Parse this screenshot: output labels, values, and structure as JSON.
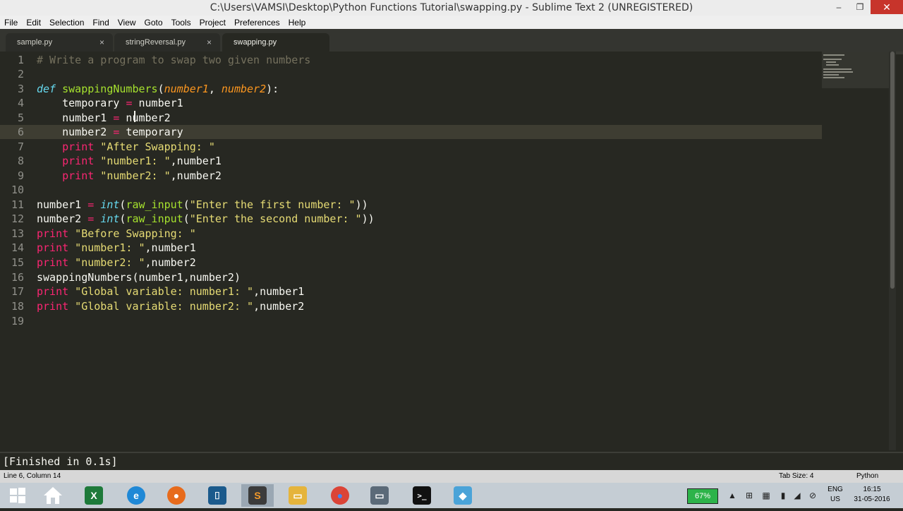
{
  "window": {
    "title": "C:\\Users\\VAMSI\\Desktop\\Python Functions Tutorial\\swapping.py - Sublime Text 2 (UNREGISTERED)",
    "minimize": "–",
    "maximize": "❐",
    "close": "✕"
  },
  "menu": [
    "File",
    "Edit",
    "Selection",
    "Find",
    "View",
    "Goto",
    "Tools",
    "Project",
    "Preferences",
    "Help"
  ],
  "tabs": [
    {
      "label": "sample.py",
      "close": "×"
    },
    {
      "label": "stringReversal.py",
      "close": "×"
    },
    {
      "label": "swapping.py",
      "close": ""
    }
  ],
  "editor": {
    "line_numbers": [
      "1",
      "2",
      "3",
      "4",
      "5",
      "6",
      "7",
      "8",
      "9",
      "10",
      "11",
      "12",
      "13",
      "14",
      "15",
      "16",
      "17",
      "18",
      "19"
    ],
    "l1": "# Write a program to swap two given numbers",
    "l3": {
      "def": "def",
      "name": "swappingNumbers",
      "open": "(",
      "p1": "number1",
      "comma": ", ",
      "p2": "number2",
      "close": "):"
    },
    "l4": {
      "a": "    temporary ",
      "op": "=",
      "b": " number1"
    },
    "l5": {
      "a": "    number1 ",
      "op": "=",
      "b": " number2"
    },
    "l6": {
      "a": "    number2 ",
      "op": "=",
      "b": " temporary"
    },
    "l7": {
      "kw": "    print",
      "str": " \"After Swapping: \""
    },
    "l8": {
      "kw": "    print",
      "str": " \"number1: \"",
      "rest": ",number1"
    },
    "l9": {
      "kw": "    print",
      "str": " \"number2: \"",
      "rest": ",number2"
    },
    "l11": {
      "a": "number1 ",
      "op": "=",
      "sp": " ",
      "fn": "int",
      "p": "(",
      "fn2": "raw_input",
      "p2": "(",
      "str": "\"Enter the first number: \"",
      "end": "))"
    },
    "l12": {
      "a": "number2 ",
      "op": "=",
      "sp": " ",
      "fn": "int",
      "p": "(",
      "fn2": "raw_input",
      "p2": "(",
      "str": "\"Enter the second number: \"",
      "end": "))"
    },
    "l13": {
      "kw": "print",
      "str": " \"Before Swapping: \""
    },
    "l14": {
      "kw": "print",
      "str": " \"number1: \"",
      "rest": ",number1"
    },
    "l15": {
      "kw": "print",
      "str": " \"number2: \"",
      "rest": ",number2"
    },
    "l16": "swappingNumbers(number1,number2)",
    "l17": {
      "kw": "print",
      "str": " \"Global variable: number1: \"",
      "rest": ",number1"
    },
    "l18": {
      "kw": "print",
      "str": " \"Global variable: number2: \"",
      "rest": ",number2"
    },
    "current_line": 6
  },
  "output": {
    "text": "[Finished in 0.1s]"
  },
  "statusbar": {
    "position": "Line 6, Column 14",
    "tab_size": "Tab Size: 4",
    "syntax": "Python"
  },
  "taskbar": {
    "apps": [
      {
        "name": "excel",
        "glyph": "X",
        "color": "#1e7a3a"
      },
      {
        "name": "internet-explorer",
        "glyph": "e",
        "color": "#1f88d6"
      },
      {
        "name": "firefox",
        "glyph": "●",
        "color": "#e76b1c"
      },
      {
        "name": "app",
        "glyph": "⌷",
        "color": "#1b5a8c"
      },
      {
        "name": "sublime-text",
        "glyph": "S",
        "color": "#3b3b3b"
      },
      {
        "name": "file-explorer",
        "glyph": "▭",
        "color": "#e5b43c"
      },
      {
        "name": "chrome",
        "glyph": "●",
        "color": "#db4437"
      },
      {
        "name": "folder",
        "glyph": "▭",
        "color": "#5b6a78"
      },
      {
        "name": "command-prompt",
        "glyph": ">_",
        "color": "#111111"
      },
      {
        "name": "app2",
        "glyph": "◆",
        "color": "#4aa3d8"
      }
    ],
    "battery": "67%",
    "language": "ENG",
    "region": "US",
    "time": "16:15",
    "date": "31-05-2016"
  }
}
